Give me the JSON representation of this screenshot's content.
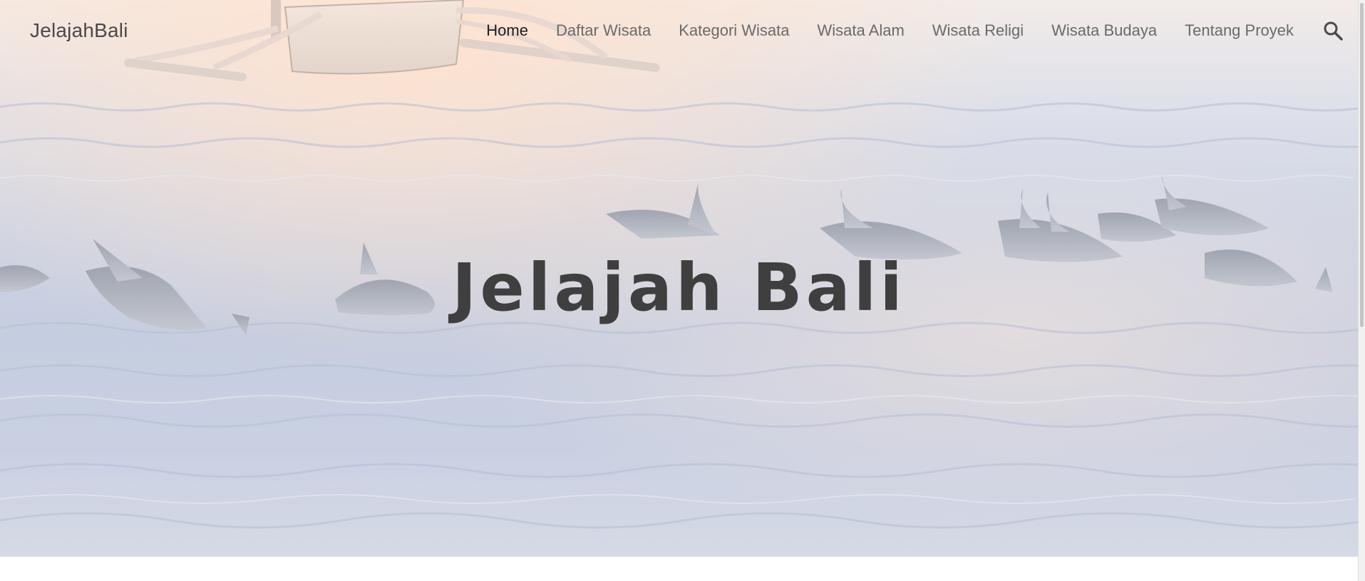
{
  "brand": "JelajahBali",
  "nav": {
    "items": [
      {
        "label": "Home",
        "active": true
      },
      {
        "label": "Daftar Wisata",
        "active": false
      },
      {
        "label": "Kategori Wisata",
        "active": false
      },
      {
        "label": "Wisata Alam",
        "active": false
      },
      {
        "label": "Wisata Religi",
        "active": false
      },
      {
        "label": "Wisata Budaya",
        "active": false
      },
      {
        "label": "Tentang Proyek",
        "active": false
      }
    ],
    "search_icon": "search-icon"
  },
  "hero": {
    "title": "Jelajah Bali",
    "image": "dolphins-swimming-sea-with-outrigger-boat"
  },
  "colors": {
    "title": "#3f3f3f",
    "nav_text": "#6a6a6a",
    "nav_active": "#1e1e1e",
    "water": "#c5cde0"
  }
}
